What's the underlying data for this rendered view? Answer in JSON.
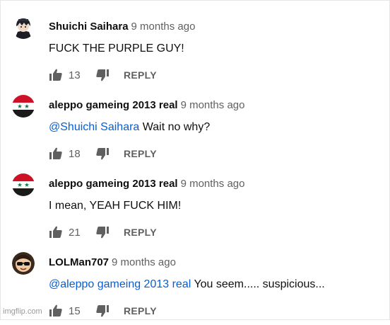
{
  "watermark": "imgflip.com",
  "reply_label": "REPLY",
  "comments": [
    {
      "author": "Shuichi Saihara",
      "time": "9 months ago",
      "mention": "",
      "text": "FUCK THE PURPLE GUY!",
      "likes": "13",
      "avatar": "anime-character-icon"
    },
    {
      "author": "aleppo gameing 2013 real",
      "time": "9 months ago",
      "mention": "@Shuichi Saihara",
      "text": "Wait no why?",
      "likes": "18",
      "avatar": "syria-flag-icon"
    },
    {
      "author": "aleppo gameing 2013 real",
      "time": "9 months ago",
      "mention": "",
      "text": "I mean, YEAH FUCK HIM!",
      "likes": "21",
      "avatar": "syria-flag-icon"
    },
    {
      "author": "LOLMan707",
      "time": "9 months ago",
      "mention": "@aleppo gameing 2013 real",
      "text": "You seem..... suspicious...",
      "likes": "15",
      "avatar": "sunglasses-face-icon"
    }
  ],
  "colors": {
    "mention": "#065fd4",
    "meta": "#606060",
    "flag_red": "#ce1126",
    "flag_green": "#007a3d"
  }
}
